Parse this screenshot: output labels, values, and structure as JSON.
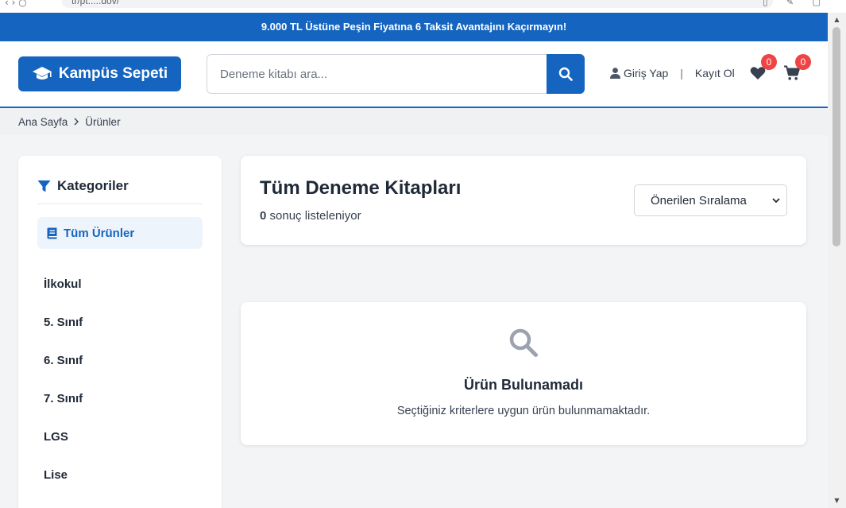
{
  "browser": {
    "nav": "‹  ›  ○",
    "url": "tr/pt.....dov/",
    "tools": "▯ ✎ ▢"
  },
  "promo": {
    "text": "9.000 TL Üstüne Peşin Fiyatına 6 Taksit Avantajını Kaçırmayın!"
  },
  "header": {
    "logo_text": "Kampüs Sepeti",
    "search_placeholder": "Deneme kitabı ara...",
    "login_label": "Giriş Yap",
    "separator": "|",
    "register_label": "Kayıt Ol",
    "wishlist_count": "0",
    "cart_count": "0"
  },
  "breadcrumb": {
    "home": "Ana Sayfa",
    "current": "Ürünler"
  },
  "sidebar": {
    "title": "Kategoriler",
    "active_item": "Tüm Ürünler",
    "items": [
      "İlkokul",
      "5. Sınıf",
      "6. Sınıf",
      "7. Sınıf",
      "LGS",
      "Lise"
    ]
  },
  "results": {
    "title": "Tüm Deneme Kitapları",
    "count": "0",
    "count_suffix": " sonuç listeleniyor",
    "sort_selected": "Önerilen Sıralama"
  },
  "empty_state": {
    "title": "Ürün Bulunamadı",
    "description": "Seçtiğiniz kriterlere uygun ürün bulunmamaktadır."
  },
  "colors": {
    "primary": "#1565c0",
    "badge": "#ef4444",
    "muted_icon": "#9ca3af"
  }
}
